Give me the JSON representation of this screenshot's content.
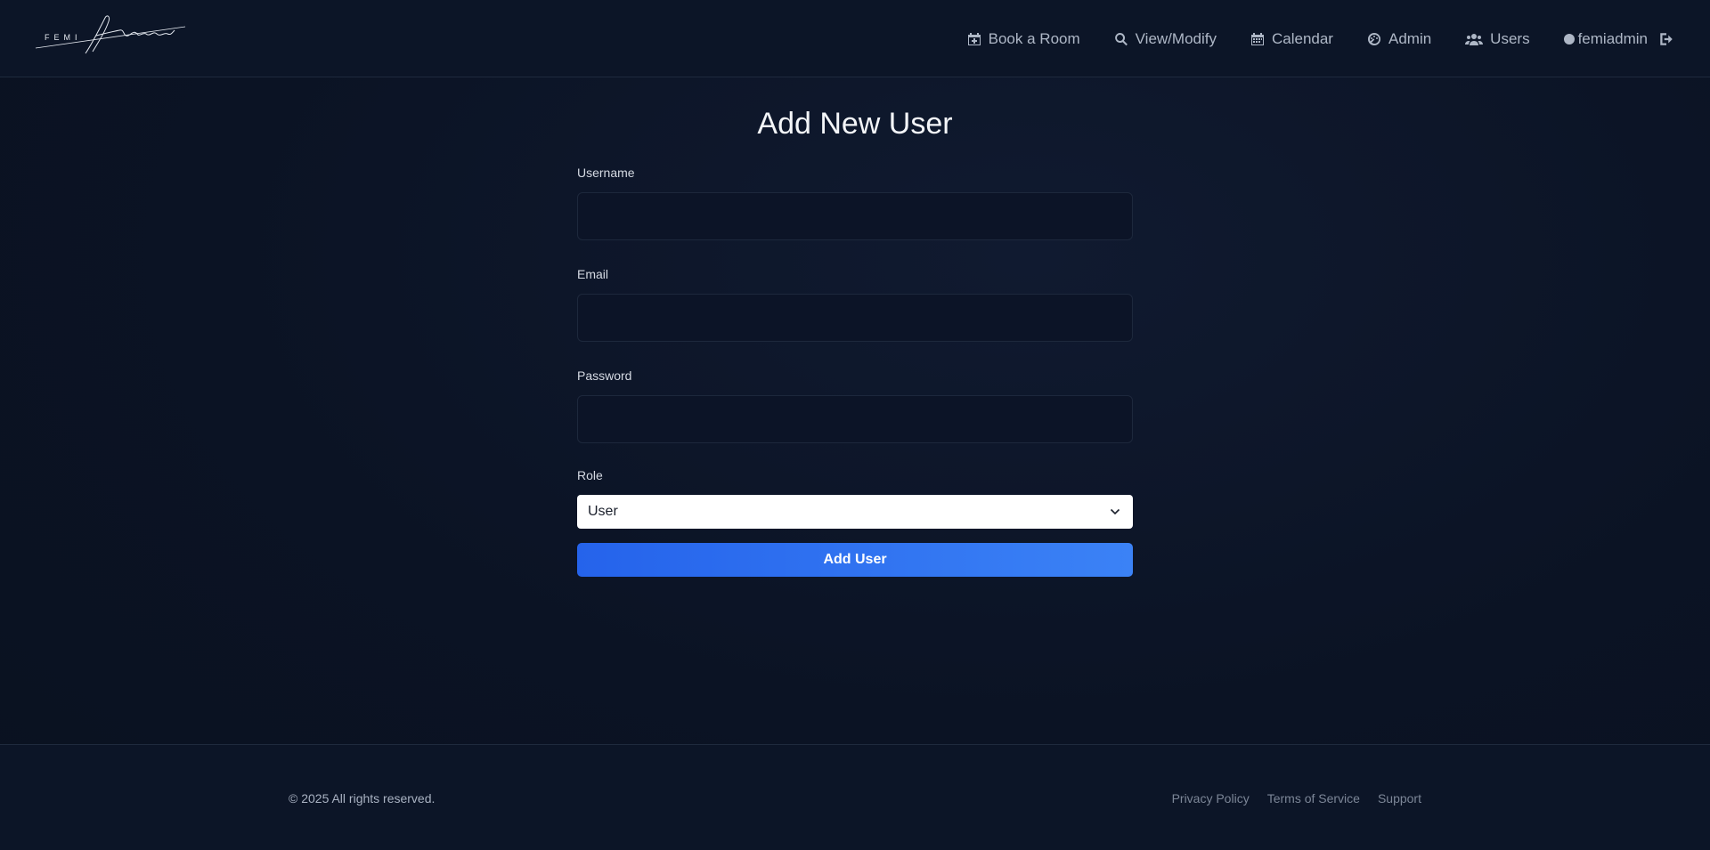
{
  "header": {
    "nav": [
      {
        "label": "Book a Room",
        "icon": "calendar-plus-icon"
      },
      {
        "label": "View/Modify",
        "icon": "search-icon"
      },
      {
        "label": "Calendar",
        "icon": "calendar-icon"
      },
      {
        "label": "Admin",
        "icon": "gauge-icon"
      },
      {
        "label": "Users",
        "icon": "users-icon"
      }
    ],
    "username": "femiadmin"
  },
  "main": {
    "title": "Add New User",
    "form": {
      "username_label": "Username",
      "username_value": "",
      "email_label": "Email",
      "email_value": "",
      "password_label": "Password",
      "password_value": "",
      "role_label": "Role",
      "role_selected": "User",
      "submit_label": "Add User"
    }
  },
  "footer": {
    "copyright": "© 2025 All rights reserved.",
    "links": [
      "Privacy Policy",
      "Terms of Service",
      "Support"
    ]
  },
  "colors": {
    "background": "#0b1324",
    "accent": "#2563eb",
    "accent_light": "#3b82f6"
  }
}
